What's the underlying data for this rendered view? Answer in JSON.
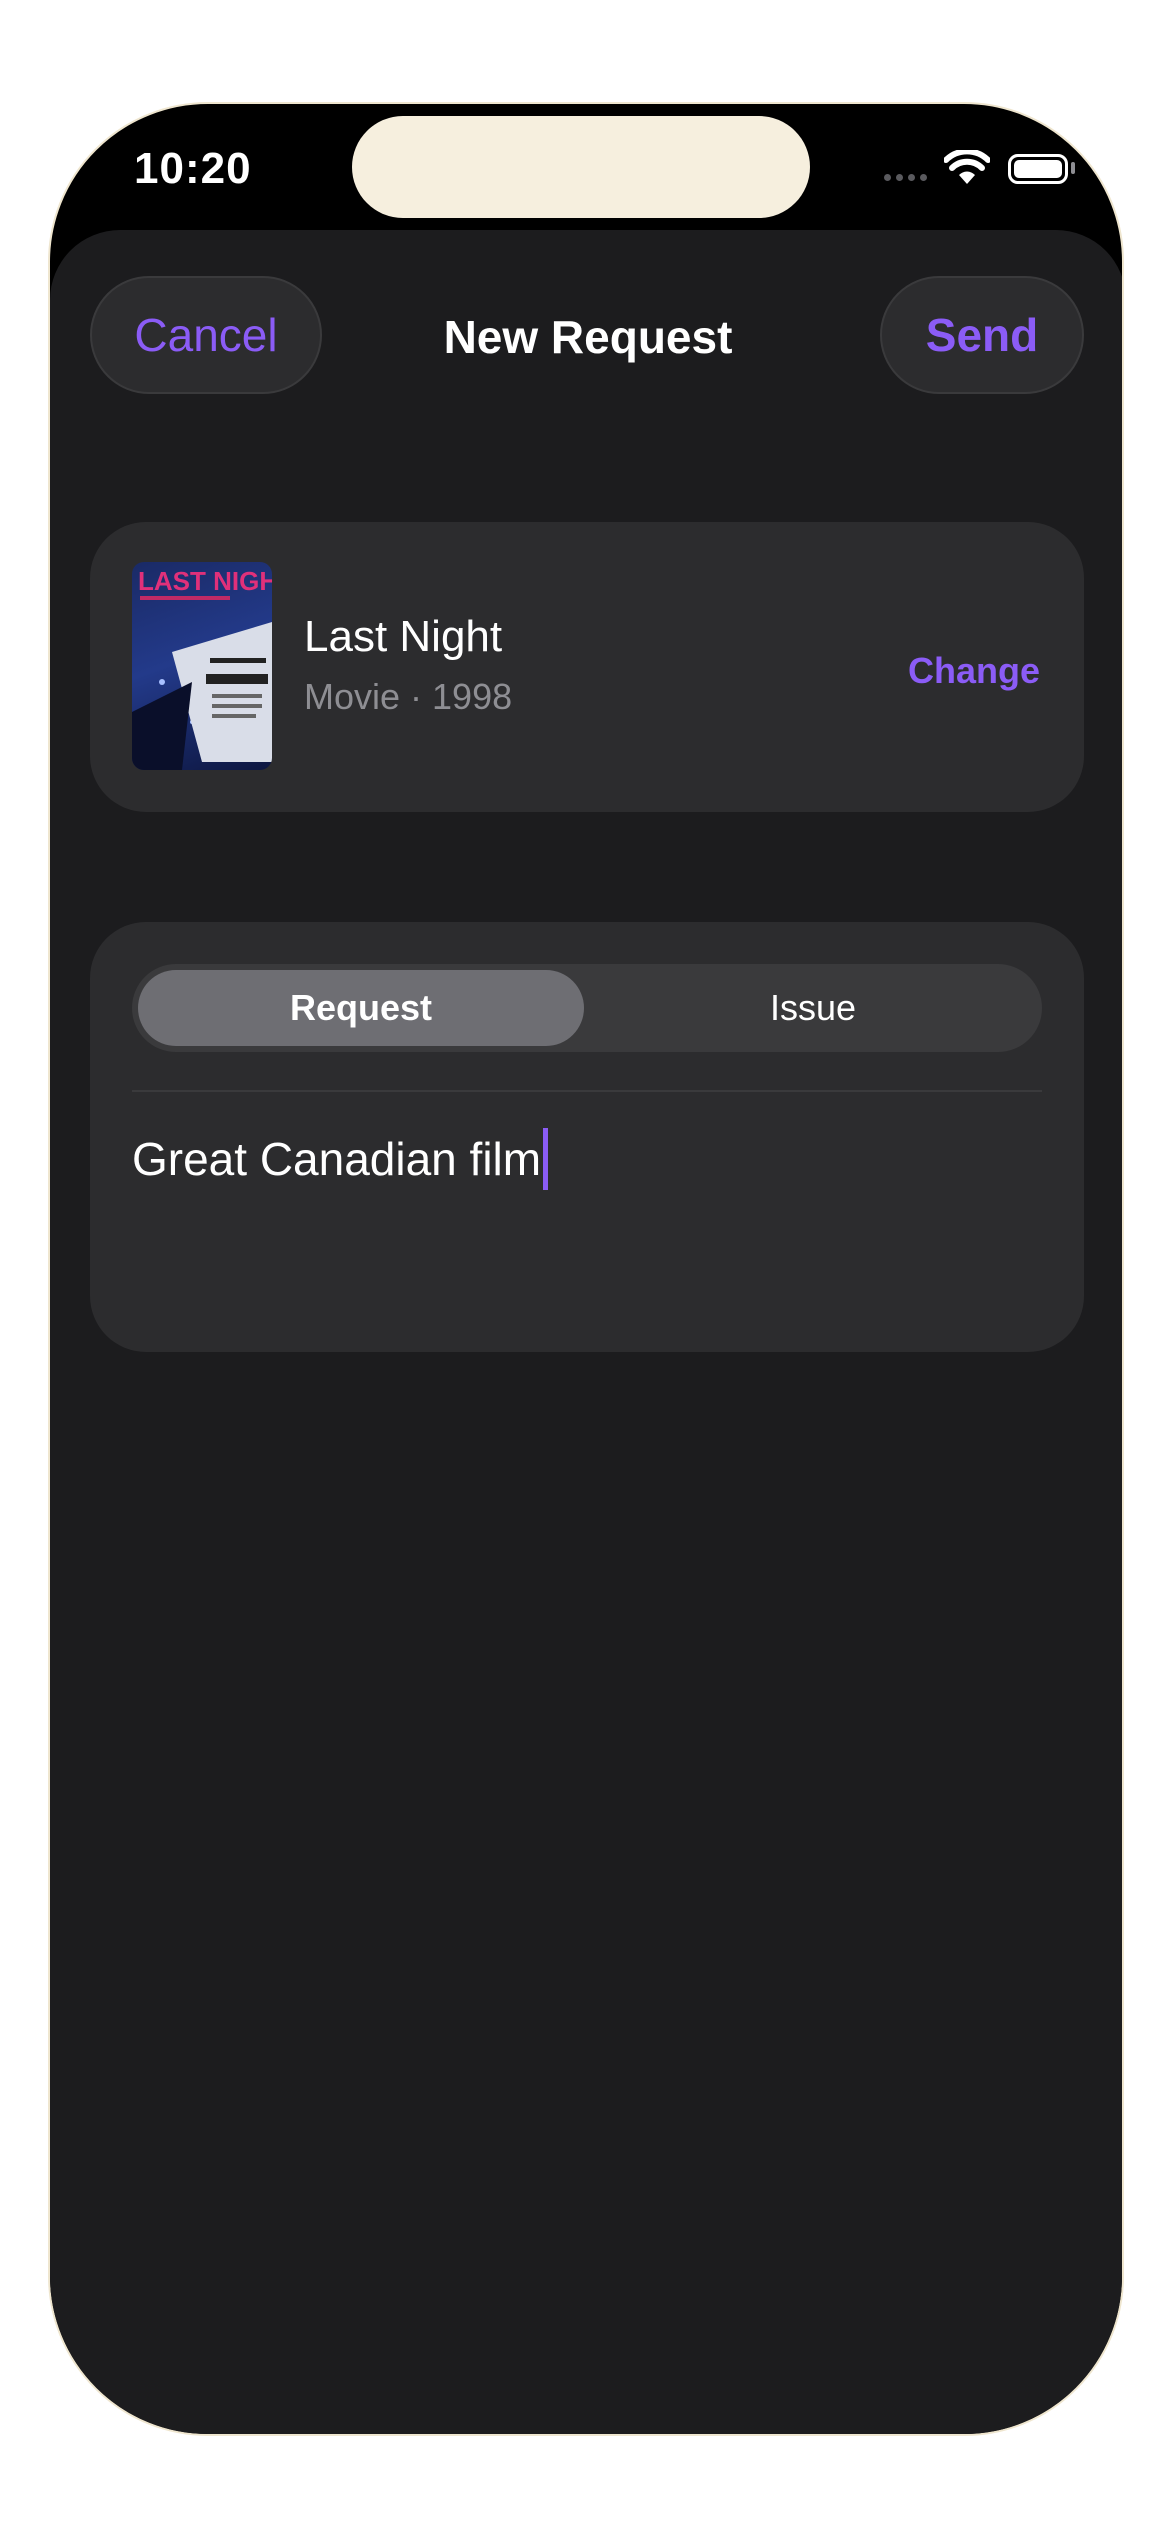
{
  "status_bar": {
    "time": "10:20"
  },
  "nav": {
    "cancel_label": "Cancel",
    "title": "New Request",
    "send_label": "Send"
  },
  "media": {
    "poster_text": "LAST NIGHT",
    "title": "Last Night",
    "subtitle": "Movie · 1998",
    "change_label": "Change"
  },
  "request_form": {
    "tabs": [
      {
        "label": "Request",
        "selected": true
      },
      {
        "label": "Issue",
        "selected": false
      }
    ],
    "note_value": "Great Canadian film"
  },
  "colors": {
    "accent": "#8b5cf6",
    "background": "#1c1c1e",
    "card": "#2c2c2e"
  }
}
